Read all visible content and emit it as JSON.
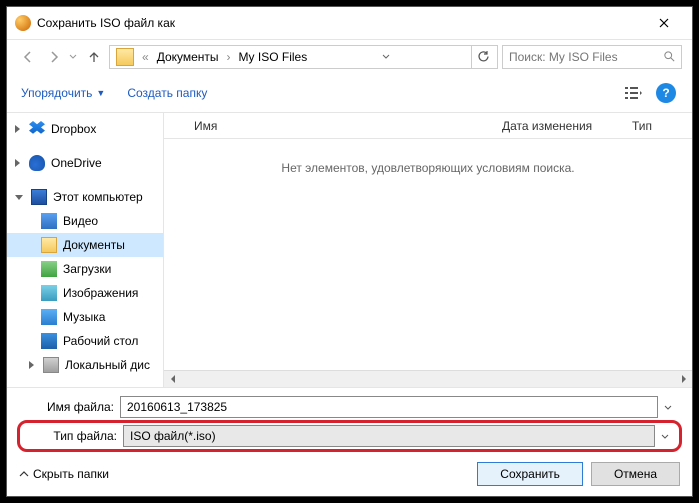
{
  "title": "Сохранить ISO файл как",
  "breadcrumb": {
    "ellipsis": "«",
    "seg1": "Документы",
    "seg2": "My ISO Files"
  },
  "search": {
    "placeholder": "Поиск: My ISO Files"
  },
  "toolbar": {
    "organize": "Упорядочить",
    "new_folder": "Создать папку"
  },
  "sidebar": {
    "dropbox": "Dropbox",
    "onedrive": "OneDrive",
    "pc": "Этот компьютер",
    "video": "Видео",
    "docs": "Документы",
    "downloads": "Загрузки",
    "images": "Изображения",
    "music": "Музыка",
    "desktop": "Рабочий стол",
    "localdisk": "Локальный дис"
  },
  "columns": {
    "name": "Имя",
    "date": "Дата изменения",
    "type": "Тип"
  },
  "empty_text": "Нет элементов, удовлетворяющих условиям поиска.",
  "footer": {
    "filename_label": "Имя файла:",
    "filename_value": "20160613_173825",
    "filetype_label": "Тип файла:",
    "filetype_value": "ISO файл(*.iso)",
    "hide_folders": "Скрыть папки",
    "save": "Сохранить",
    "cancel": "Отмена"
  }
}
